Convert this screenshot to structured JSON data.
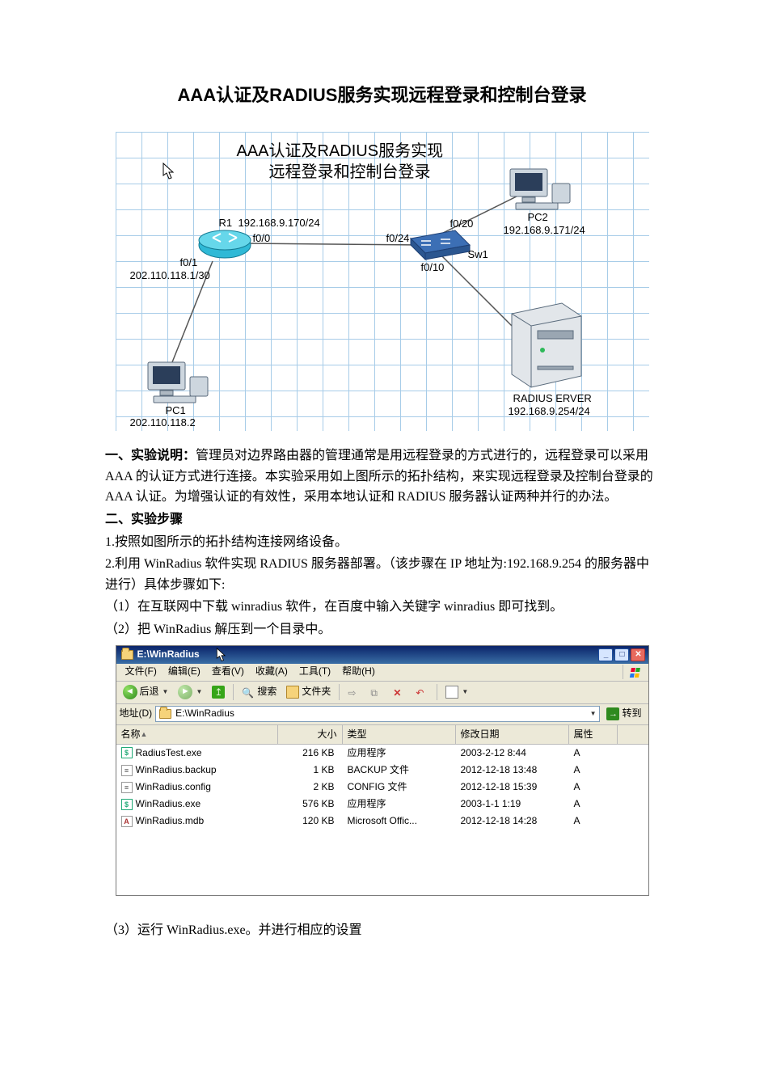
{
  "doc": {
    "title": "AAA认证及RADIUS服务实现远程登录和控制台登录",
    "section1_head": "一、实验说明：",
    "section1_body": "管理员对边界路由器的管理通常是用远程登录的方式进行的，远程登录可以采用 AAA 的认证方式进行连接。本实验采用如上图所示的拓扑结构，来实现远程登录及控制台登录的 AAA 认证。为增强认证的有效性，采用本地认证和 RADIUS 服务器认证两种并行的办法。",
    "section2_head": "二、实验步骤",
    "step1": "1.按照如图所示的拓扑结构连接网络设备。",
    "step2a": "2.利用 WinRadius 软件实现 RADIUS 服务器部署。（该步骤在 IP 地址为:192.168.9.254 的服务器中进行）具体步骤如下:",
    "step2_1": "（1）在互联网中下载 winradius 软件，在百度中输入关键字 winradius 即可找到。",
    "step2_2": "（2）把 WinRadius 解压到一个目录中。",
    "step2_3": "（3）运行 WinRadius.exe。并进行相应的设置"
  },
  "diagram": {
    "title1": "AAA认证及RADIUS服务实现",
    "title2": "远程登录和控制台登录",
    "r1": "R1",
    "r1_ip": "192.168.9.170/24",
    "r1_f00": "f0/0",
    "r1_f01": "f0/1",
    "r1_f01_ip": "202.110.118.1/30",
    "sw1": "Sw1",
    "sw_f024": "f0/24",
    "sw_f020": "f0/20",
    "sw_f010": "f0/10",
    "pc1": "PC1",
    "pc1_ip": "202.110.118.2",
    "pc2": "PC2",
    "pc2_ip": "192.168.9.171/24",
    "srv": "RADIUS ERVER",
    "srv_ip": "192.168.9.254/24"
  },
  "explorer": {
    "title": "E:\\WinRadius",
    "menus": {
      "file": "文件(F)",
      "edit": "编辑(E)",
      "view": "查看(V)",
      "fav": "收藏(A)",
      "tools": "工具(T)",
      "help": "帮助(H)"
    },
    "tb": {
      "back": "后退",
      "search": "搜索",
      "folders": "文件夹"
    },
    "addr": {
      "label": "地址(D)",
      "value": "E:\\WinRadius",
      "go": "转到"
    },
    "cols": {
      "name": "名称",
      "size": "大小",
      "type": "类型",
      "date": "修改日期",
      "attr": "属性"
    },
    "files": [
      {
        "icon": "exe",
        "name": "RadiusTest.exe",
        "size": "216 KB",
        "type": "应用程序",
        "date": "2003-2-12 8:44",
        "attr": "A"
      },
      {
        "icon": "cfg",
        "name": "WinRadius.backup",
        "size": "1 KB",
        "type": "BACKUP 文件",
        "date": "2012-12-18 13:48",
        "attr": "A"
      },
      {
        "icon": "cfg",
        "name": "WinRadius.config",
        "size": "2 KB",
        "type": "CONFIG 文件",
        "date": "2012-12-18 15:39",
        "attr": "A"
      },
      {
        "icon": "exe",
        "name": "WinRadius.exe",
        "size": "576 KB",
        "type": "应用程序",
        "date": "2003-1-1 1:19",
        "attr": "A"
      },
      {
        "icon": "mdb",
        "name": "WinRadius.mdb",
        "size": "120 KB",
        "type": "Microsoft Offic...",
        "date": "2012-12-18 14:28",
        "attr": "A"
      }
    ]
  }
}
